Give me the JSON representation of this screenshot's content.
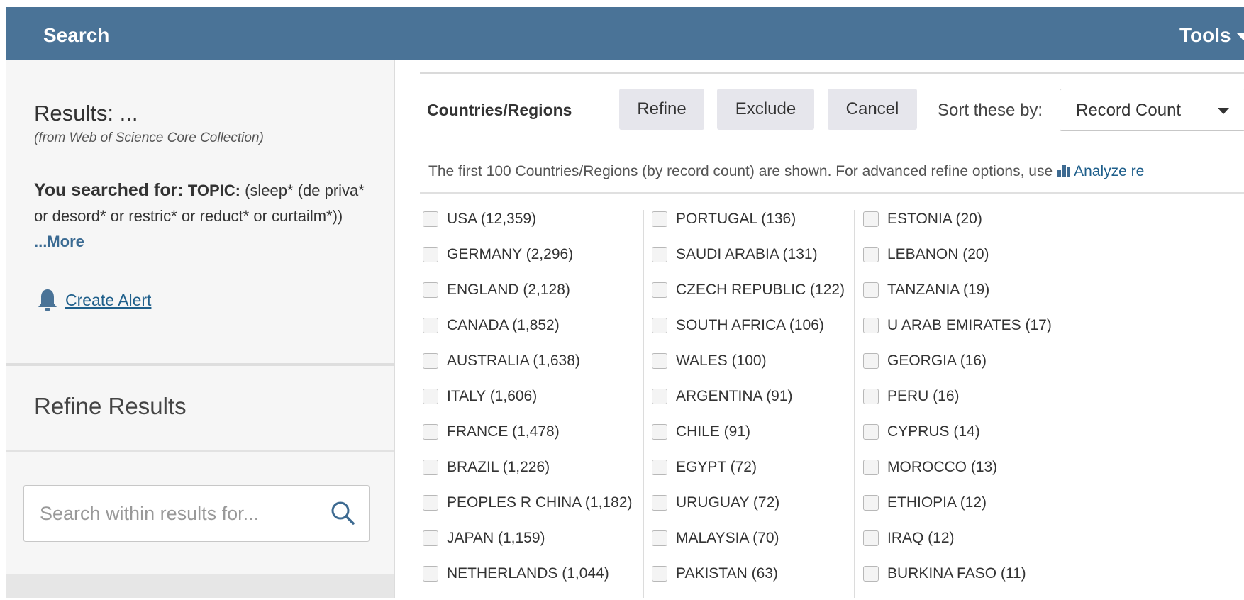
{
  "header": {
    "search_tab": "Search",
    "tools_label": "Tools"
  },
  "left": {
    "results_title": "Results: ...",
    "results_source": "(from Web of Science Core Collection)",
    "searched_label": "You searched for:",
    "topic_label": "TOPIC:",
    "query_text": " (sleep* (de priva* or desord* or restric* or reduct* or curtailm*))",
    "more_link": " ...More",
    "create_alert": "Create Alert",
    "refine_title": "Refine Results",
    "search_placeholder": "Search within results for..."
  },
  "refine_panel": {
    "label": "Countries/Regions",
    "refine_button": "Refine",
    "exclude_button": "Exclude",
    "cancel_button": "Cancel",
    "sort_label": "Sort these by:",
    "sort_value": "Record Count",
    "info_text": "The first 100 Countries/Regions (by record count) are shown. For advanced refine options, use",
    "analyze_link": "Analyze re"
  },
  "columns": [
    [
      "USA (12,359)",
      "GERMANY (2,296)",
      "ENGLAND (2,128)",
      "CANADA (1,852)",
      "AUSTRALIA (1,638)",
      "ITALY (1,606)",
      "FRANCE (1,478)",
      "BRAZIL (1,226)",
      "PEOPLES R CHINA (1,182)",
      "JAPAN (1,159)",
      "NETHERLANDS (1,044)"
    ],
    [
      "PORTUGAL (136)",
      "SAUDI ARABIA (131)",
      "CZECH REPUBLIC (122)",
      "SOUTH AFRICA (106)",
      "WALES (100)",
      "ARGENTINA (91)",
      "CHILE (91)",
      "EGYPT (72)",
      "URUGUAY (72)",
      "MALAYSIA (70)",
      "PAKISTAN (63)"
    ],
    [
      "ESTONIA (20)",
      "LEBANON (20)",
      "TANZANIA (19)",
      "U ARAB EMIRATES (17)",
      "GEORGIA (16)",
      "PERU (16)",
      "CYPRUS (14)",
      "MOROCCO (13)",
      "ETHIOPIA (12)",
      "IRAQ (12)",
      "BURKINA FASO (11)"
    ]
  ],
  "colors": {
    "header_bg": "#4a7397",
    "link": "#1f5f8b",
    "button_bg": "#e6e6ec"
  }
}
